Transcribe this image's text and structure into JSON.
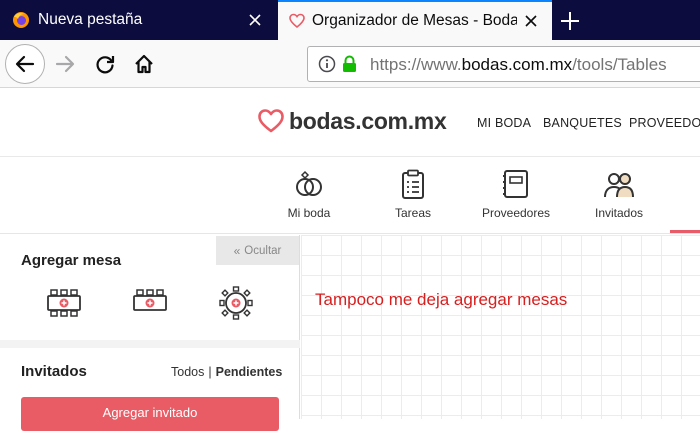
{
  "browser": {
    "tabs": [
      {
        "title": "Nueva pestaña",
        "active": false,
        "icon": "firefox-icon"
      },
      {
        "title": "Organizador de Mesas - Bodas.c",
        "active": true,
        "icon": "heart-favicon-icon"
      }
    ],
    "url": {
      "scheme": "https://www.",
      "host": "bodas.com.mx",
      "path": "/tools/Tables"
    }
  },
  "site": {
    "logo_text": "bodas.com.mx",
    "top_menu": [
      "MI BODA",
      "BANQUETES",
      "PROVEEDOR"
    ],
    "sections": [
      {
        "label": "Mi boda",
        "icon": "rings-icon"
      },
      {
        "label": "Tareas",
        "icon": "clipboard-icon"
      },
      {
        "label": "Proveedores",
        "icon": "notebook-icon"
      },
      {
        "label": "Invitados",
        "icon": "guests-icon"
      }
    ],
    "accent_color": "#e95c66"
  },
  "panel": {
    "hide_label": "Ocultar",
    "add_table_title": "Agregar mesa",
    "table_types": [
      "rectangular-table-icon",
      "imperial-table-icon",
      "round-table-icon"
    ],
    "guests_title": "Invitados",
    "filter_all": "Todos",
    "filter_pending": "Pendientes",
    "add_guest_label": "Agregar invitado"
  },
  "canvas": {
    "annotation": "Tampoco me deja agregar mesas",
    "annotation_color": "#d61f1f"
  }
}
